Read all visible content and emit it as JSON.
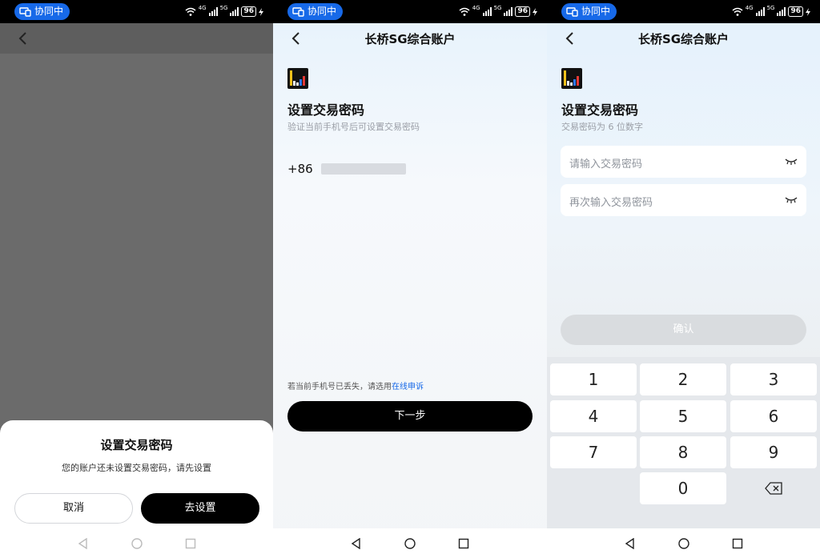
{
  "status": {
    "collab_label": "协同中",
    "signal1": "4G",
    "signal2": "5G",
    "battery": "96"
  },
  "screen1": {
    "dialog_title": "设置交易密码",
    "dialog_message": "您的账户还未设置交易密码，请先设置",
    "cancel_label": "取消",
    "goto_label": "去设置"
  },
  "screen2": {
    "title": "长桥SG综合账户",
    "heading": "设置交易密码",
    "subtitle": "验证当前手机号后可设置交易密码",
    "country_code": "+86",
    "lost_hint": "若当前手机号已丢失，请选用",
    "appeal_link": "在线申诉",
    "next_label": "下一步"
  },
  "screen3": {
    "title": "长桥SG综合账户",
    "heading": "设置交易密码",
    "subtitle": "交易密码为 6 位数字",
    "password_placeholder": "请输入交易密码",
    "confirm_password_placeholder": "再次输入交易密码",
    "confirm_label": "确认",
    "keys": [
      "1",
      "2",
      "3",
      "4",
      "5",
      "6",
      "7",
      "8",
      "9",
      "0"
    ]
  },
  "colors": {
    "accent": "#1769e8",
    "primary_button": "#000000",
    "disabled_button": "#d9dcdf",
    "dim_overlay": "#6b6b6b"
  },
  "icons": {
    "back": "chevron-left-icon",
    "eye_closed": "eye-closed-icon",
    "delete": "backspace-icon"
  }
}
